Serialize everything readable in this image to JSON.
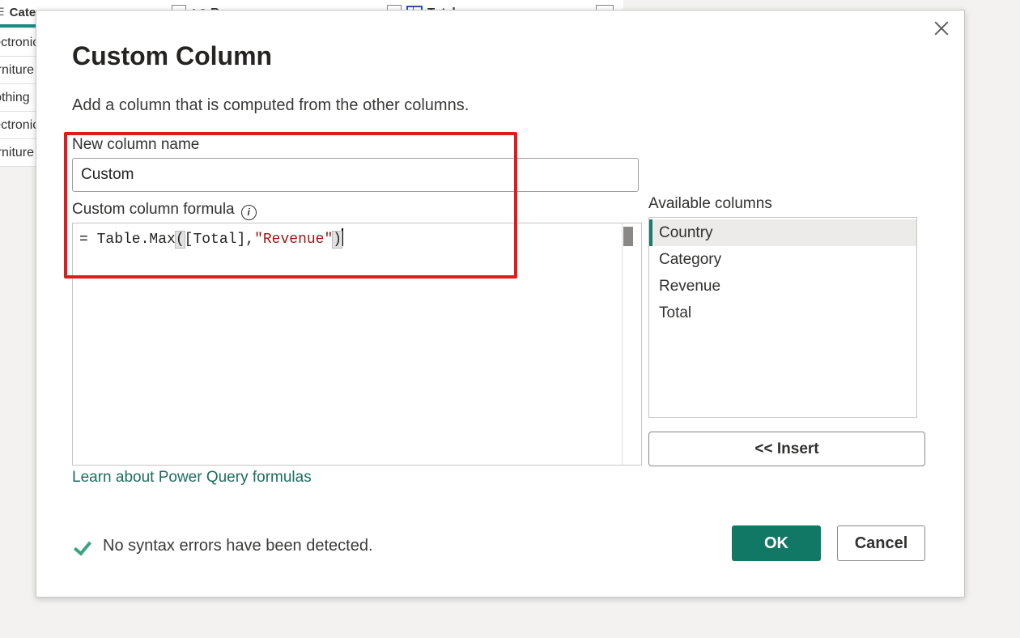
{
  "background": {
    "columns": [
      {
        "name": "Category",
        "type": "ABC"
      },
      {
        "name": "Revenue",
        "type": "1.2"
      },
      {
        "name": "Total",
        "type": "table"
      }
    ],
    "rows": [
      "Electronics",
      "Furniture",
      "Clothing",
      "Electronics",
      "Furniture"
    ]
  },
  "dialog": {
    "title": "Custom Column",
    "subtitle": "Add a column that is computed from the other columns.",
    "new_column_label": "New column name",
    "new_column_value": "Custom",
    "formula_label": "Custom column formula",
    "info_icon": "i",
    "formula": {
      "prefix": "= Table.Max",
      "open_paren": "(",
      "args": "[Total],",
      "string_arg": "\"Revenue\"",
      "close_paren": ")"
    },
    "learn_link": "Learn about Power Query formulas",
    "available_label": "Available columns",
    "available_columns": [
      "Country",
      "Category",
      "Revenue",
      "Total"
    ],
    "selected_column": "Country",
    "insert_label": "<< Insert",
    "status_text": "No syntax errors have been detected.",
    "ok_label": "OK",
    "cancel_label": "Cancel"
  },
  "colors": {
    "accent": "#117865",
    "highlight": "#e01b1b",
    "string": "#a31515",
    "check": "#3aa37e"
  }
}
